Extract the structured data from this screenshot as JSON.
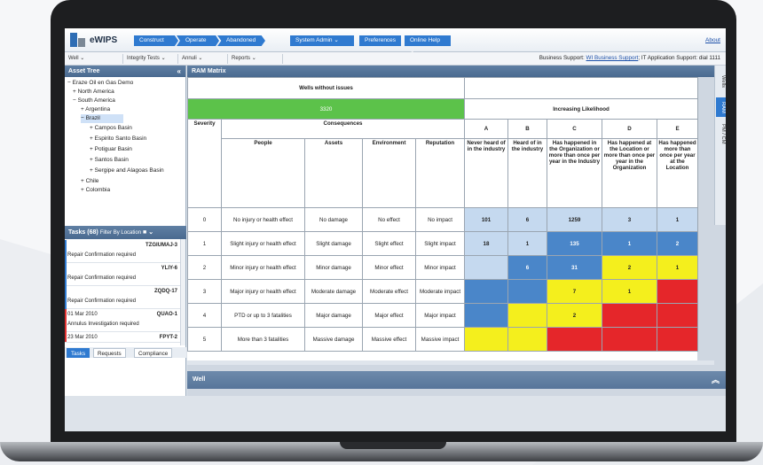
{
  "app": {
    "brand": "eWIPS",
    "about": "About"
  },
  "nav": {
    "construct": "Construct",
    "operate": "Operate",
    "abandoned": "Abandoned",
    "system_admin": "System Admin",
    "preferences": "Preferences",
    "online_help": "Online Help"
  },
  "subbar": {
    "well": "Well",
    "integrity": "Integrity Tests",
    "annuli": "Annuli",
    "reports": "Reports",
    "support_prefix": "Business Support:",
    "support_link": "WI Business Support",
    "support_suffix": "; IT Application Support: dial 1111"
  },
  "asset_tree": {
    "title": "Asset Tree",
    "items": [
      "Eraze Oil en Gas Demo",
      "North America",
      "South America",
      "Argentina",
      "Brazil",
      "Campos Basin",
      "Espirito Santo Basin",
      "Potiguar Basin",
      "Santos Basin",
      "Sergipe and Alagoas Basin",
      "Chile",
      "Colombia"
    ]
  },
  "tasks": {
    "title": "Tasks (68)",
    "filter": "Filter By Location",
    "items": [
      {
        "code": "TZGIUMAJ-3",
        "date": "",
        "text": "Repair Confirmation required",
        "color": "#2f7ad0"
      },
      {
        "code": "YLIY-6",
        "date": "",
        "text": "Repair Confirmation required",
        "color": "#2f7ad0"
      },
      {
        "code": "ZQDQ-17",
        "date": "",
        "text": "Repair Confirmation required",
        "color": "#2f7ad0"
      },
      {
        "code": "QUAO-1",
        "date": "01 Mar 2010",
        "text": "Annulus Investigation required",
        "color": "#e03030"
      },
      {
        "code": "FPYT-2",
        "date": "23 Mar 2010",
        "text": "",
        "color": "#e03030"
      }
    ],
    "tab_tasks": "Tasks",
    "tab_requests": "Requests",
    "tab_compliance": "Compliance"
  },
  "ram": {
    "title": "RAM Matrix",
    "wells_without_issues": "Wells without issues",
    "wells_count": "3320",
    "increasing_likelihood": "Increasing Likelihood",
    "severity": "Severity",
    "consequences": "Consequences",
    "cols": [
      "People",
      "Assets",
      "Environment",
      "Reputation"
    ],
    "likelihood": [
      {
        "letter": "A",
        "desc": "Never heard of in the industry"
      },
      {
        "letter": "B",
        "desc": "Heard of in the industry"
      },
      {
        "letter": "C",
        "desc": "Has happened in the Organization or more than once per year in the Industry"
      },
      {
        "letter": "D",
        "desc": "Has happened at the Location or more than once per year in the Organization"
      },
      {
        "letter": "E",
        "desc": "Has happened more than once per year at the Location"
      }
    ],
    "rows": [
      {
        "sev": "0",
        "people": "No injury or health effect",
        "assets": "No damage",
        "env": "No effect",
        "rep": "No impact",
        "cells": [
          "101",
          "6",
          "1259",
          "3",
          "1"
        ]
      },
      {
        "sev": "1",
        "people": "Slight injury or health effect",
        "assets": "Slight damage",
        "env": "Slight effect",
        "rep": "Slight impact",
        "cells": [
          "18",
          "1",
          "135",
          "1",
          "2"
        ]
      },
      {
        "sev": "2",
        "people": "Minor injury or health effect",
        "assets": "Minor damage",
        "env": "Minor effect",
        "rep": "Minor impact",
        "cells": [
          "",
          "6",
          "31",
          "2",
          "1"
        ]
      },
      {
        "sev": "3",
        "people": "Major injury or health effect",
        "assets": "Moderate damage",
        "env": "Moderate effect",
        "rep": "Moderate impact",
        "cells": [
          "",
          "",
          "7",
          "1",
          ""
        ]
      },
      {
        "sev": "4",
        "people": "PTD or up to 3 fatalities",
        "assets": "Major damage",
        "env": "Major effect",
        "rep": "Major impact",
        "cells": [
          "",
          "",
          "2",
          "",
          ""
        ]
      },
      {
        "sev": "5",
        "people": "More than 3 fatalities",
        "assets": "Massive damage",
        "env": "Massive effect",
        "rep": "Massive impact",
        "cells": [
          "",
          "",
          "",
          "",
          ""
        ]
      }
    ]
  },
  "colors": {
    "light_blue": "#c5d9ef",
    "blue": "#4a86c9",
    "yellow": "#f4ef1d",
    "red": "#e5262a",
    "green": "#5cc24a"
  },
  "vtabs": {
    "wells": "Wells",
    "ram": "RAM",
    "pm_cm": "PM / CM"
  },
  "well_panel": {
    "title": "Well"
  }
}
